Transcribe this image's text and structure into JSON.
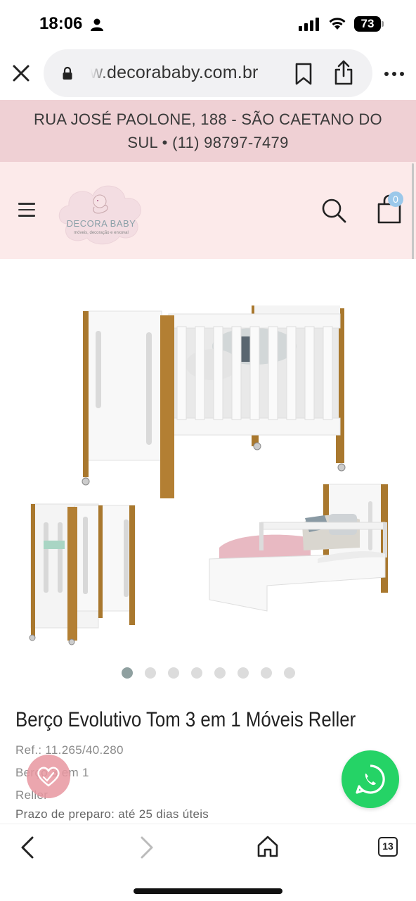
{
  "status_bar": {
    "time": "18:06",
    "battery": "73"
  },
  "browser": {
    "url": "w.decorababy.com.br",
    "icons": [
      "close-icon",
      "lock-icon",
      "bookmark-icon",
      "share-icon",
      "more-icon"
    ]
  },
  "banner": {
    "address": "RUA JOSÉ PAOLONE, 188 - SÃO CAETANO DO SUL • (11) 98797-7479"
  },
  "header": {
    "logo_text": "DECORA BABY",
    "logo_subtext": "móveis, decoração e enxoval",
    "cart_count": "0",
    "colors": {
      "banner_bg": "#efd0d4",
      "header_bg": "#fceaea",
      "badge": "#9bc8ea"
    }
  },
  "gallery": {
    "dots": 8,
    "active_dot": 0
  },
  "product": {
    "title": "Berço Evolutivo Tom 3 em 1 Móveis Reller",
    "ref": "Ref.: 11.265/40.280",
    "category": "Berço 3 em 1",
    "brand": "Reller",
    "prep_time": "Prazo de preparo: até 25 dias úteis"
  },
  "floating": {
    "whatsapp_color": "#25d366"
  },
  "bottom_nav": {
    "tab_count": "13"
  }
}
